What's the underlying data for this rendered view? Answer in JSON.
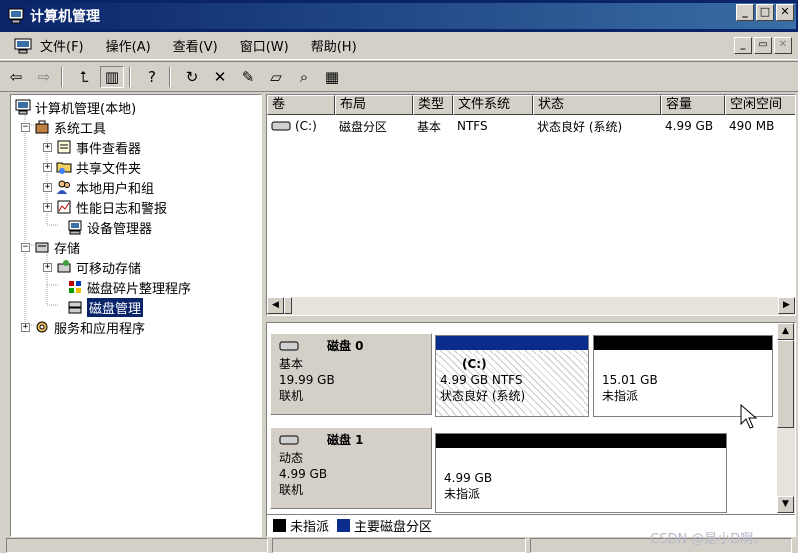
{
  "window": {
    "title": "计算机管理",
    "minimize": "_",
    "restore": "□",
    "close": "✕"
  },
  "menu": {
    "items": [
      "文件(F)",
      "操作(A)",
      "查看(V)",
      "窗口(W)",
      "帮助(H)"
    ],
    "mdi_minimize": "_",
    "mdi_restore": "▭",
    "mdi_close": "✕"
  },
  "toolbar": {
    "buttons": [
      {
        "name": "back-button",
        "icon": "arrow-left-icon",
        "glyph": "⇦"
      },
      {
        "name": "forward-button",
        "icon": "arrow-right-icon",
        "glyph": "⇨"
      },
      {
        "name": "up-level-button",
        "icon": "up-folder-icon",
        "glyph": "⮤"
      },
      {
        "name": "show-hide-tree-button",
        "icon": "console-tree-icon",
        "glyph": "▥"
      },
      {
        "name": "help-button",
        "icon": "help-icon",
        "glyph": "?"
      },
      {
        "name": "refresh-button",
        "icon": "refresh-icon",
        "glyph": "↻"
      },
      {
        "name": "delete-button",
        "icon": "delete-icon",
        "glyph": "✕"
      },
      {
        "name": "properties-button",
        "icon": "properties-icon",
        "glyph": "✎"
      },
      {
        "name": "open-button",
        "icon": "open-folder-icon",
        "glyph": "▱"
      },
      {
        "name": "search-button",
        "icon": "search-icon",
        "glyph": "⌕"
      },
      {
        "name": "settings-button",
        "icon": "settings-icon",
        "glyph": "▦"
      }
    ]
  },
  "tree": {
    "root": "计算机管理(本地)",
    "system_tools": "系统工具",
    "event_viewer": "事件查看器",
    "shared_folders": "共享文件夹",
    "local_users": "本地用户和组",
    "perf_logs": "性能日志和警报",
    "device_manager": "设备管理器",
    "storage": "存储",
    "removable_storage": "可移动存储",
    "defrag": "磁盘碎片整理程序",
    "disk_management": "磁盘管理",
    "services_apps": "服务和应用程序"
  },
  "volume_list": {
    "headers": [
      "卷",
      "布局",
      "类型",
      "文件系统",
      "状态",
      "容量",
      "空闲空间"
    ],
    "rows": [
      [
        "(C:)",
        "磁盘分区",
        "基本",
        "NTFS",
        "状态良好 (系统)",
        "4.99 GB",
        "490 MB"
      ]
    ]
  },
  "disks": [
    {
      "name": "磁盘 0",
      "type": "基本",
      "size": "19.99 GB",
      "status": "联机",
      "partitions": [
        {
          "label": "(C:)",
          "line1": "4.99 GB NTFS",
          "line2": "状态良好 (系统)"
        },
        {
          "label": "",
          "line1": "15.01 GB",
          "line2": "未指派"
        }
      ]
    },
    {
      "name": "磁盘 1",
      "type": "动态",
      "size": "4.99 GB",
      "status": "联机",
      "partitions": [
        {
          "label": "",
          "line1": "4.99 GB",
          "line2": "未指派"
        }
      ]
    }
  ],
  "legend": {
    "unallocated": "未指派",
    "primary": "主要磁盘分区",
    "unallocated_color": "#000000",
    "primary_color": "#0a2c8c"
  },
  "colors": {
    "title_bar": "#0a246a",
    "primary_partition": "#0a2c8c",
    "unallocated": "#000000",
    "selection": "#0a246a"
  },
  "watermark": "CSDN @是小D啊、"
}
